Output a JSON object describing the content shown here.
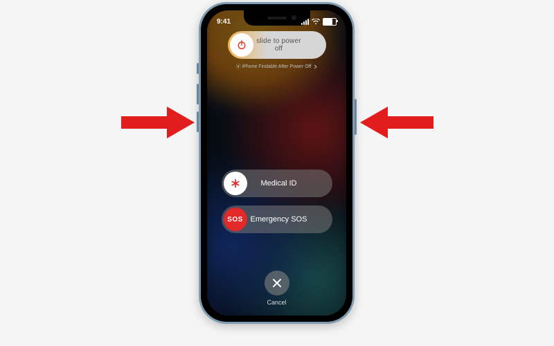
{
  "status": {
    "time": "9:41"
  },
  "power_slider": {
    "label": "slide to power off"
  },
  "findable": {
    "text": "iPhone Findable After Power Off"
  },
  "medical": {
    "label": "Medical ID"
  },
  "sos": {
    "knob": "SOS",
    "label": "Emergency SOS"
  },
  "cancel": {
    "label": "Cancel"
  },
  "colors": {
    "arrow": "#e21d1d",
    "sos": "#e22828"
  }
}
